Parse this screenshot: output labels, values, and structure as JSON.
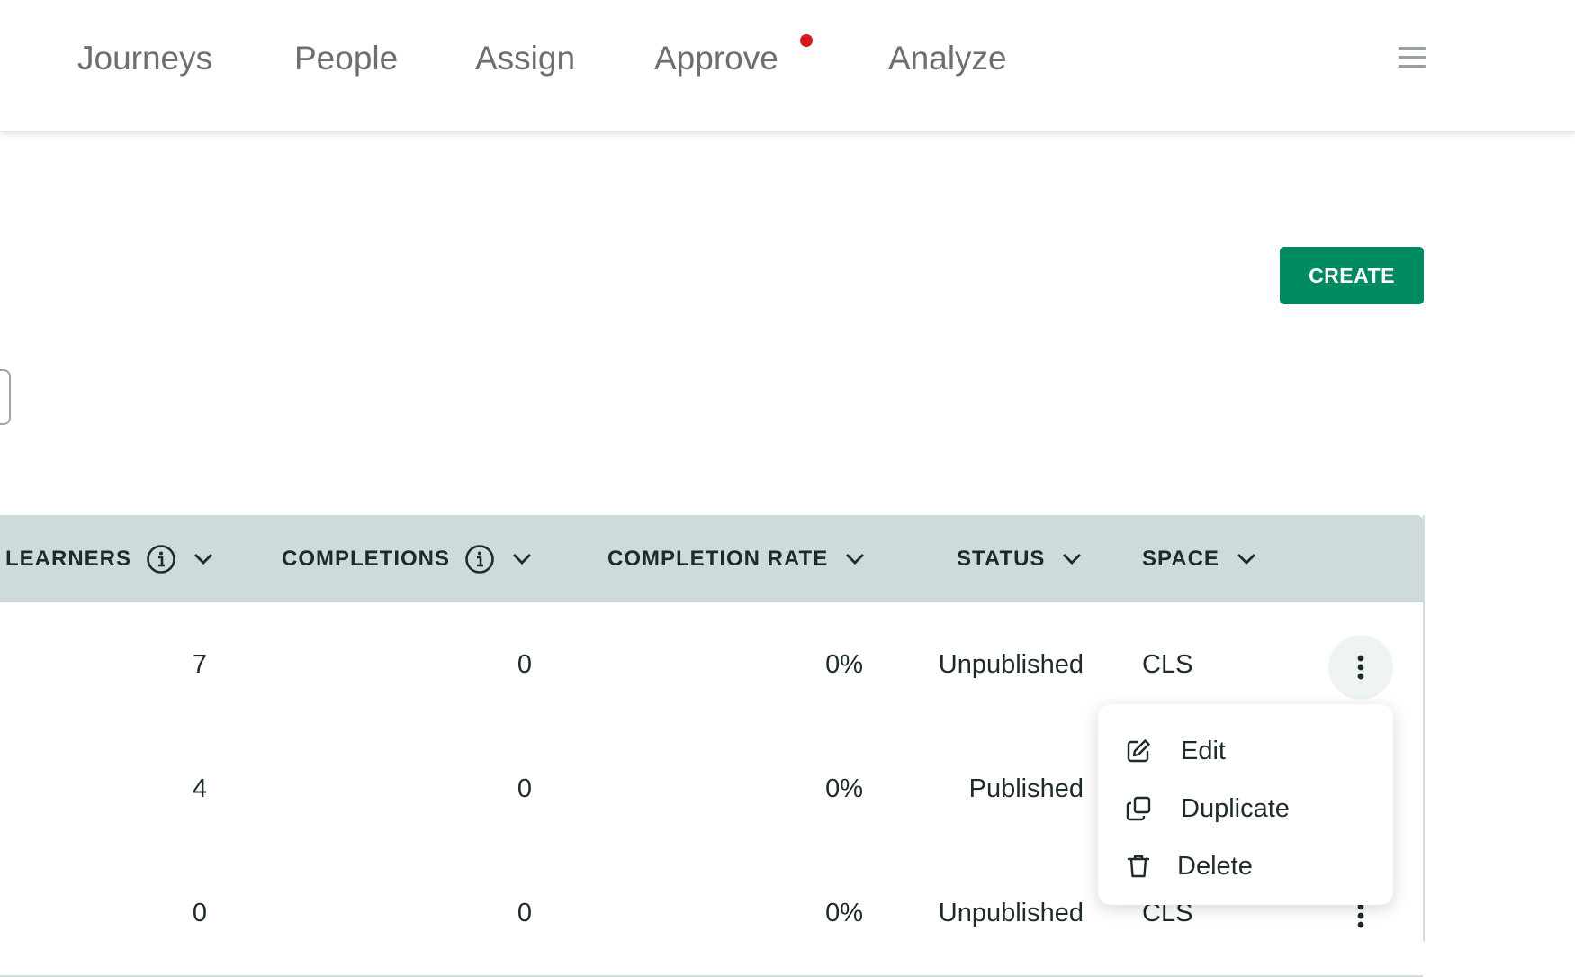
{
  "nav": {
    "items": [
      "Journeys",
      "People",
      "Assign",
      "Approve",
      "Analyze"
    ],
    "approve_has_notification": true,
    "notification_color": "#d7191e",
    "menu_icon": "hamburger-icon"
  },
  "toolbar": {
    "create_label": "CREATE",
    "create_color": "#008a5f"
  },
  "table": {
    "columns": {
      "learners": "LEARNERS",
      "completions": "COMPLETIONS",
      "completion_rate": "COMPLETION RATE",
      "status": "STATUS",
      "space": "SPACE"
    },
    "header_color": "#cfdbdb",
    "rows": [
      {
        "learners": "7",
        "completions": "0",
        "completion_rate": "0%",
        "status": "Unpublished",
        "space": "CLS"
      },
      {
        "learners": "4",
        "completions": "0",
        "completion_rate": "0%",
        "status": "Published",
        "space": ""
      },
      {
        "learners": "0",
        "completions": "0",
        "completion_rate": "0%",
        "status": "Unpublished",
        "space": "CLS"
      }
    ]
  },
  "context_menu": {
    "items": [
      {
        "label": "Edit",
        "icon": "edit-icon"
      },
      {
        "label": "Duplicate",
        "icon": "duplicate-icon"
      },
      {
        "label": "Delete",
        "icon": "trash-icon"
      }
    ]
  }
}
